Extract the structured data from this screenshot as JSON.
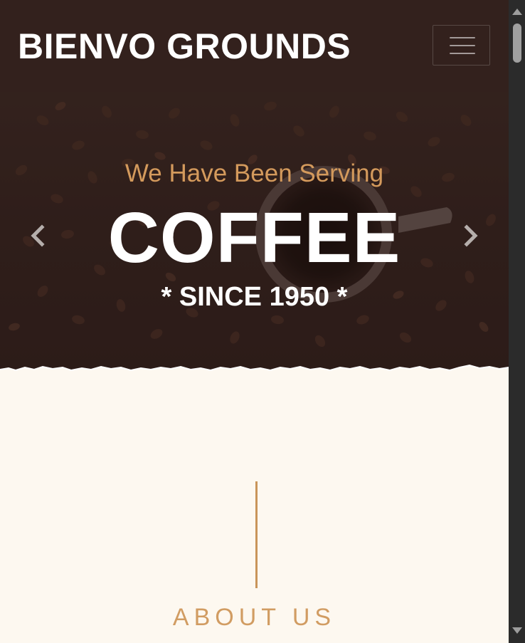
{
  "navbar": {
    "brand": "BIENVO GROUNDS",
    "toggle_icon": "hamburger-menu-icon"
  },
  "hero": {
    "subtitle": "We Have Been Serving",
    "title": "COFFEE",
    "since": "* SINCE 1950 *",
    "prev_icon": "chevron-left-icon",
    "next_icon": "chevron-right-icon",
    "accent_color": "#d49a5c",
    "background_color": "#33211d"
  },
  "about": {
    "title": "ABOUT US",
    "accent_color": "#d19c62"
  },
  "page": {
    "background_color": "#fdf8f0"
  }
}
